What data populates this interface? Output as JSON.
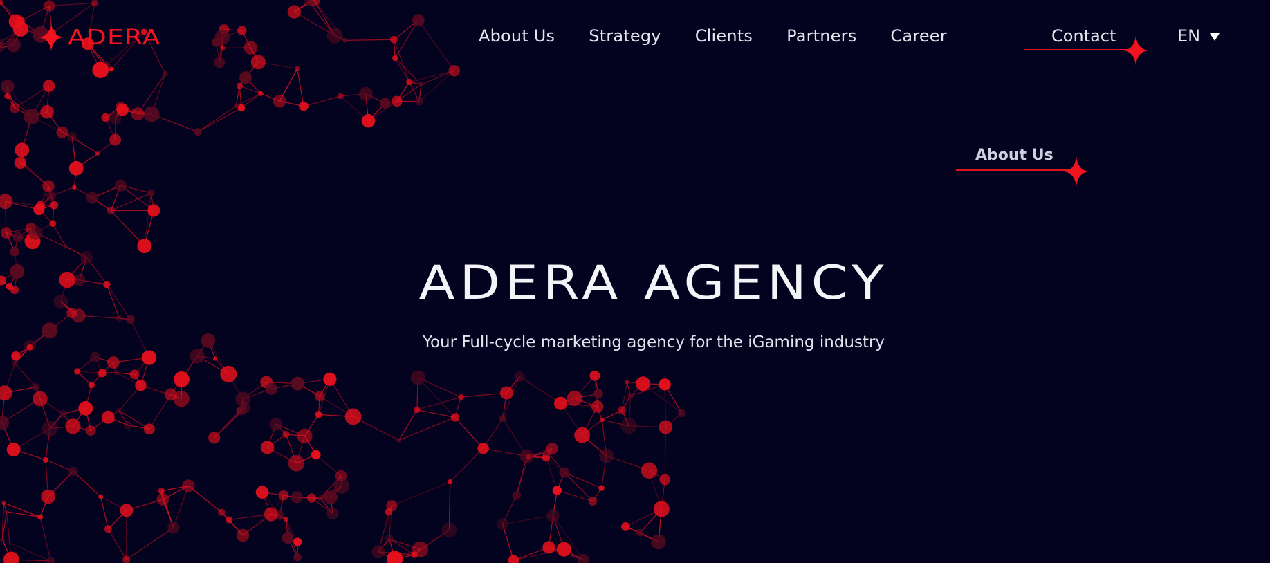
{
  "brand": {
    "name": "ADERA",
    "color": "#f0141e",
    "icon": "four-point-star-icon"
  },
  "nav": {
    "items": [
      {
        "label": "About Us"
      },
      {
        "label": "Strategy"
      },
      {
        "label": "Clients"
      },
      {
        "label": "Partners"
      },
      {
        "label": "Career"
      }
    ],
    "contact_label": "Contact",
    "language": "EN"
  },
  "about_link": {
    "label": "About Us"
  },
  "hero": {
    "title": "ADERA AGENCY",
    "subtitle": "Your Full-cycle marketing agency for the iGaming industry"
  },
  "colors": {
    "background": "#04031f",
    "accent": "#e0141c",
    "text": "#e6e6ee"
  },
  "background_graphic": "red-network-nodes"
}
